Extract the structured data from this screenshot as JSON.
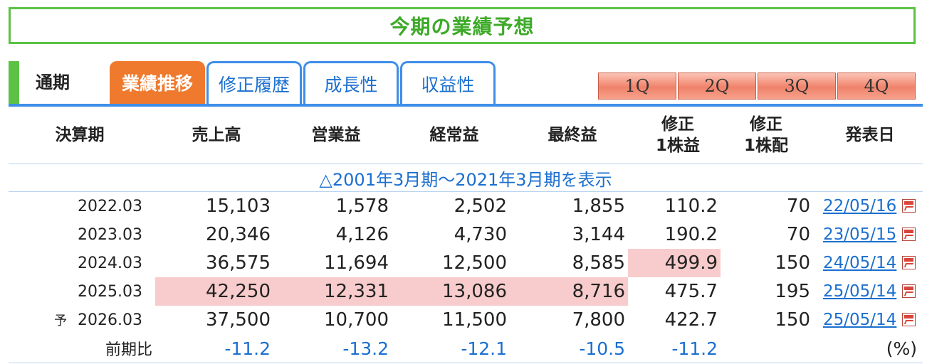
{
  "title": "今期の業績予想",
  "tabs": {
    "period_label": "通期",
    "items": [
      {
        "label": "業績推移",
        "active": true
      },
      {
        "label": "修正履歴",
        "active": false
      },
      {
        "label": "成長性",
        "active": false
      },
      {
        "label": "収益性",
        "active": false
      }
    ],
    "quarters": [
      "1Q",
      "2Q",
      "3Q",
      "4Q"
    ]
  },
  "table": {
    "headers": {
      "period": "決算期",
      "sales": "売上高",
      "operating": "営業益",
      "ordinary": "経常益",
      "net": "最終益",
      "eps_line1": "修正",
      "eps_line2": "1株益",
      "dps_line1": "修正",
      "dps_line2": "1株配",
      "announce": "発表日"
    },
    "expand_link": "△2001年3月期～2021年3月期を表示",
    "rows": [
      {
        "forecast_mark": "",
        "period": "2022.03",
        "sales": "15,103",
        "operating": "1,578",
        "ordinary": "2,502",
        "net": "1,855",
        "eps": "110.2",
        "dps": "70",
        "date": "22/05/16"
      },
      {
        "forecast_mark": "",
        "period": "2023.03",
        "sales": "20,346",
        "operating": "4,126",
        "ordinary": "4,730",
        "net": "3,144",
        "eps": "190.2",
        "dps": "70",
        "date": "23/05/15"
      },
      {
        "forecast_mark": "",
        "period": "2024.03",
        "sales": "36,575",
        "operating": "11,694",
        "ordinary": "12,500",
        "net": "8,585",
        "eps": "499.9",
        "dps": "150",
        "date": "24/05/14"
      },
      {
        "forecast_mark": "",
        "period": "2025.03",
        "sales": "42,250",
        "operating": "12,331",
        "ordinary": "13,086",
        "net": "8,716",
        "eps": "475.7",
        "dps": "195",
        "date": "25/05/14"
      },
      {
        "forecast_mark": "予",
        "period": "2026.03",
        "sales": "37,500",
        "operating": "10,700",
        "ordinary": "11,500",
        "net": "7,800",
        "eps": "422.7",
        "dps": "150",
        "date": "25/05/14"
      }
    ],
    "change_row": {
      "label": "前期比",
      "sales": "-11.2",
      "operating": "-13.2",
      "ordinary": "-12.1",
      "net": "-10.5",
      "eps": "-11.2",
      "unit": "(%)"
    }
  },
  "colors": {
    "accent_green": "#5cc245",
    "active_tab": "#ef7a2e",
    "link_blue": "#1b6fcf",
    "highlight_pink": "#f8cccc"
  }
}
